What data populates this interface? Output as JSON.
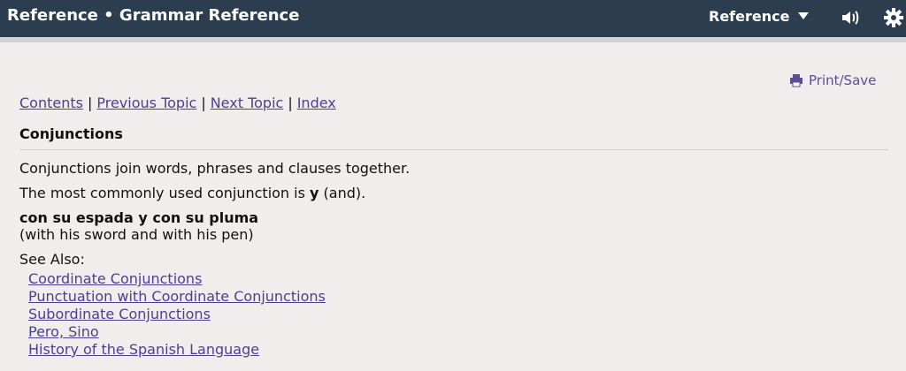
{
  "header": {
    "title": "Reference • Grammar Reference",
    "reference_select": "Reference"
  },
  "toolbar": {
    "print_label": "Print/Save"
  },
  "nav": {
    "contents": "Contents",
    "previous": "Previous Topic",
    "next": "Next Topic",
    "index": "Index",
    "separator": "|"
  },
  "article": {
    "heading": "Conjunctions",
    "para1": "Conjunctions join words, phrases and clauses together.",
    "para2_prefix": "The most commonly used conjunction is ",
    "para2_bold": "y",
    "para2_suffix": " (and).",
    "example_spanish": "con su espada y con su pluma",
    "example_english": "(with his sword and with his pen)",
    "see_also_label": "See Also:",
    "see_also_links": [
      "Coordinate Conjunctions",
      "Punctuation with Coordinate Conjunctions",
      "Subordinate Conjunctions",
      "Pero, Sino",
      "History of the Spanish Language"
    ]
  },
  "colors": {
    "header_bg": "#2d3d50",
    "link": "#4b3f91",
    "page_bg": "#efeeec"
  },
  "icons": [
    "chevron-down-icon",
    "speaker-icon",
    "gear-icon",
    "printer-icon"
  ]
}
